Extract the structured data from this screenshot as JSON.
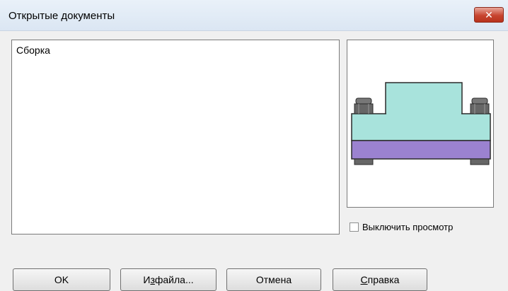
{
  "window": {
    "title": "Открытые документы",
    "close_icon": "close-icon"
  },
  "document_list": {
    "items": [
      "Сборка"
    ]
  },
  "preview": {
    "colors": {
      "body": "#a8e3dc",
      "plate": "#9b82d0",
      "bolts": "#6b6b6b",
      "outline": "#2b2b2b"
    }
  },
  "options": {
    "disable_preview_label": "Выключить просмотр",
    "disable_preview_checked": false
  },
  "buttons": {
    "ok": "OK",
    "from_file_prefix": "И",
    "from_file_hotkey": "з",
    "from_file_suffix": " файла...",
    "cancel": "Отмена",
    "help_prefix": "",
    "help_hotkey": "С",
    "help_suffix": "правка"
  }
}
